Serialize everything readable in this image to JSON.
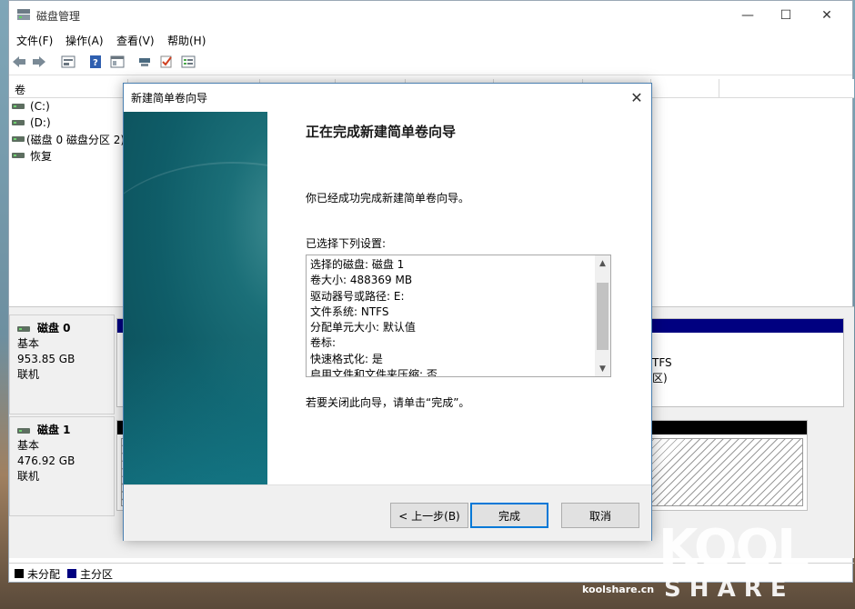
{
  "window": {
    "title": "磁盘管理",
    "minimize": "—",
    "maximize": "☐",
    "close": "✕"
  },
  "menu": [
    "文件(F)",
    "操作(A)",
    "查看(V)",
    "帮助(H)"
  ],
  "toolbar_icons": [
    "back-arrow-icon",
    "forward-arrow-icon",
    "properties-icon",
    "help-icon",
    "view-icon",
    "connect-icon",
    "check-icon",
    "disk-list-icon"
  ],
  "volume_list": {
    "column_header": "卷",
    "rows": [
      "(C:)",
      "(D:)",
      "(磁盘 0 磁盘分区 2)",
      "恢复"
    ]
  },
  "disks": [
    {
      "name": "磁盘 0",
      "type": "基本",
      "size": "953.85 GB",
      "status": "联机",
      "partition_text_1": "TFS",
      "partition_text_2": "区)"
    },
    {
      "name": "磁盘 1",
      "type": "基本",
      "size": "476.92 GB",
      "status": "联机"
    }
  ],
  "legend": {
    "unallocated": "未分配",
    "primary": "主分区",
    "unallocated_color": "#000000",
    "primary_color": "#000080"
  },
  "dialog": {
    "title": "新建简单卷向导",
    "heading": "正在完成新建简单卷向导",
    "message": "你已经成功完成新建简单卷向导。",
    "settings_label": "已选择下列设置:",
    "settings": [
      "选择的磁盘: 磁盘 1",
      "卷大小: 488369 MB",
      "驱动器号或路径: E:",
      "文件系统: NTFS",
      "分配单元大小: 默认值",
      "卷标:",
      "快速格式化: 是",
      "启用文件和文件夹压缩: 否"
    ],
    "close_hint": "若要关闭此向导，请单击“完成”。",
    "back_button": "< 上一步(B)",
    "finish_button": "完成",
    "cancel_button": "取消"
  },
  "watermark": {
    "site": "koolshare.cn",
    "logo_top": "KOOL",
    "logo_bottom": "S H A R E"
  }
}
